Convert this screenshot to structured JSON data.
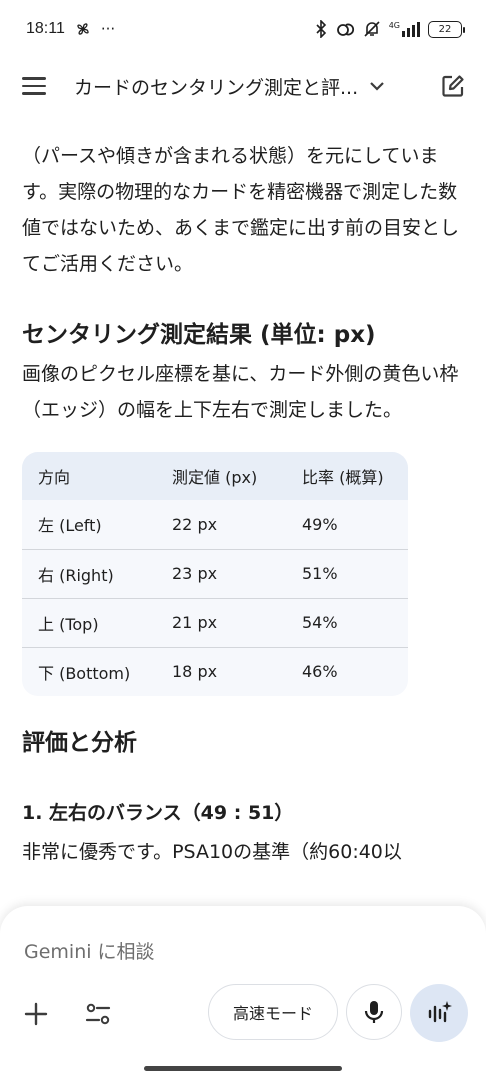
{
  "status_bar": {
    "time": "18:11",
    "overflow": "···",
    "network": "4G",
    "battery": "22",
    "icons": [
      "pinwheel-icon",
      "bluetooth-icon",
      "link-icon",
      "bell-off-icon",
      "signal-icon",
      "battery-icon"
    ]
  },
  "app_bar": {
    "title": "カードのセンタリング測定と評...",
    "icons": [
      "menu-icon",
      "chevron-down-icon",
      "edit-icon"
    ]
  },
  "content": {
    "intro": "（パースや傾きが含まれる状態）を元にしています。実際の物理的なカードを精密機器で測定した数値ではないため、あくまで鑑定に出す前の目安としてご活用ください。",
    "section1_title": "センタリング測定結果 (単位: px)",
    "section1_body": "画像のピクセル座標を基に、カード外側の黄色い枠（エッジ）の幅を上下左右で測定しました。",
    "table": {
      "headers": [
        "方向",
        "測定値 (px)",
        "比率 (概算)"
      ],
      "rows": [
        [
          "左 (Left)",
          "22 px",
          "49%"
        ],
        [
          "右 (Right)",
          "23 px",
          "51%"
        ],
        [
          "上 (Top)",
          "21 px",
          "54%"
        ],
        [
          "下 (Bottom)",
          "18 px",
          "46%"
        ]
      ]
    },
    "section2_title": "評価と分析",
    "subsection_title": "1. 左右のバランス（49 : 51）",
    "subsection_body": "非常に優秀です。PSA10の基準（約60:40以"
  },
  "input_panel": {
    "placeholder": "Gemini に相談",
    "mode_label": "高速モード",
    "icons": [
      "plus-icon",
      "tools-icon",
      "mic-icon",
      "live-icon"
    ]
  },
  "colors": {
    "table_header_bg": "#e8eef7",
    "table_body_bg": "#f6f8fc",
    "live_button_bg": "#dde6f4"
  }
}
